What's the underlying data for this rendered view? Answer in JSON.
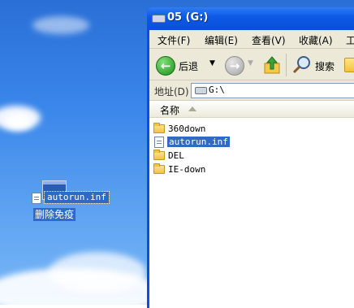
{
  "desktop": {
    "dragged_file": "autorun.inf",
    "shortcut_caption": "删除免疫"
  },
  "window": {
    "title": "05 (G:)",
    "menu": [
      "文件(F)",
      "编辑(E)",
      "查看(V)",
      "收藏(A)",
      "工"
    ],
    "toolbar": {
      "back_label": "后退",
      "search_label": "搜索"
    },
    "address": {
      "label": "地址(D)",
      "value": "G:\\"
    },
    "columns": {
      "name": "名称"
    },
    "items": [
      {
        "name": "360down",
        "type": "folder",
        "selected": false
      },
      {
        "name": "autorun.inf",
        "type": "file",
        "selected": true
      },
      {
        "name": "DEL",
        "type": "folder",
        "selected": false
      },
      {
        "name": "IE-down",
        "type": "folder",
        "selected": false
      }
    ]
  },
  "colors": {
    "selection": "#316ac5",
    "titlebar": "#0a4ee3",
    "chrome": "#ece9d8"
  }
}
